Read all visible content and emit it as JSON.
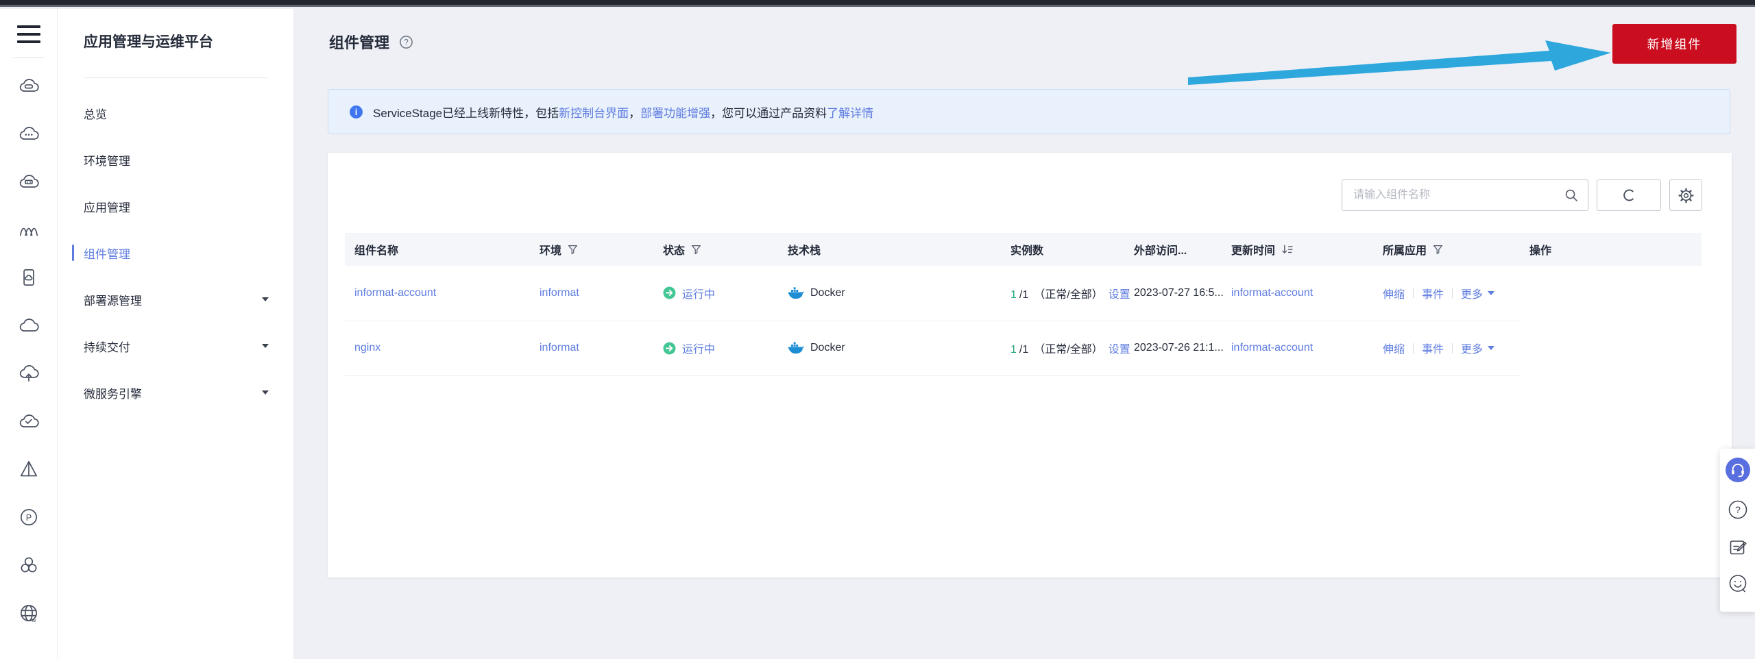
{
  "sidebar": {
    "title": "应用管理与运维平台",
    "items": [
      {
        "label": "总览",
        "selected": false,
        "expandable": false
      },
      {
        "label": "环境管理",
        "selected": false,
        "expandable": false
      },
      {
        "label": "应用管理",
        "selected": false,
        "expandable": false
      },
      {
        "label": "组件管理",
        "selected": true,
        "expandable": false
      },
      {
        "label": "部署源管理",
        "selected": false,
        "expandable": true
      },
      {
        "label": "持续交付",
        "selected": false,
        "expandable": true
      },
      {
        "label": "微服务引擎",
        "selected": false,
        "expandable": true
      }
    ]
  },
  "header": {
    "title": "组件管理",
    "create_button": "新增组件"
  },
  "banner": {
    "text_before": "ServiceStage已经上线新特性，包括",
    "link_console": "新控制台界面",
    "comma1": "，",
    "link_deploy": "部署功能增强",
    "text_mid": "，您可以通过产品资料",
    "link_details": "了解详情"
  },
  "toolbar": {
    "search_placeholder": "请输入组件名称"
  },
  "table": {
    "columns": [
      "组件名称",
      "环境",
      "状态",
      "技术栈",
      "实例数",
      "外部访问...",
      "更新时间",
      "所属应用",
      "操作"
    ],
    "rows": [
      {
        "name": "informat-account",
        "env": "informat",
        "status": "运行中",
        "stack": "Docker",
        "inst_ok": "1",
        "inst_total": "/1",
        "inst_note": "（正常/全部）",
        "inst_link": "设置",
        "updated": "2023-07-27 16:5...",
        "app": "informat-account",
        "action_scale": "伸缩",
        "action_event": "事件",
        "action_more": "更多"
      },
      {
        "name": "nginx",
        "env": "informat",
        "status": "运行中",
        "stack": "Docker",
        "inst_ok": "1",
        "inst_total": "/1",
        "inst_note": "（正常/全部）",
        "inst_link": "设置",
        "updated": "2023-07-26 21:1...",
        "app": "informat-account",
        "action_scale": "伸缩",
        "action_event": "事件",
        "action_more": "更多"
      }
    ]
  },
  "icons": {
    "rail": [
      "hamburger-menu",
      "cloud-hdd",
      "cloud-dots",
      "cloud-box",
      "waves",
      "server-card",
      "cloud",
      "cloud-upload",
      "cloud-check",
      "prism",
      "circle-p",
      "three-circles",
      "globe"
    ],
    "float_panel": [
      "headset",
      "help",
      "feedback-edit",
      "smiley"
    ]
  },
  "colors": {
    "accent_red": "#cb0e1f",
    "link_blue": "#5e7ce0",
    "success_green": "#44c695",
    "instance_green": "#23a97a",
    "annotation_arrow_blue": "#2ea7dd",
    "content_bg": "#eef0f5",
    "banner_bg": "#e9f1fc",
    "table_header_bg": "#f4f6fa"
  }
}
